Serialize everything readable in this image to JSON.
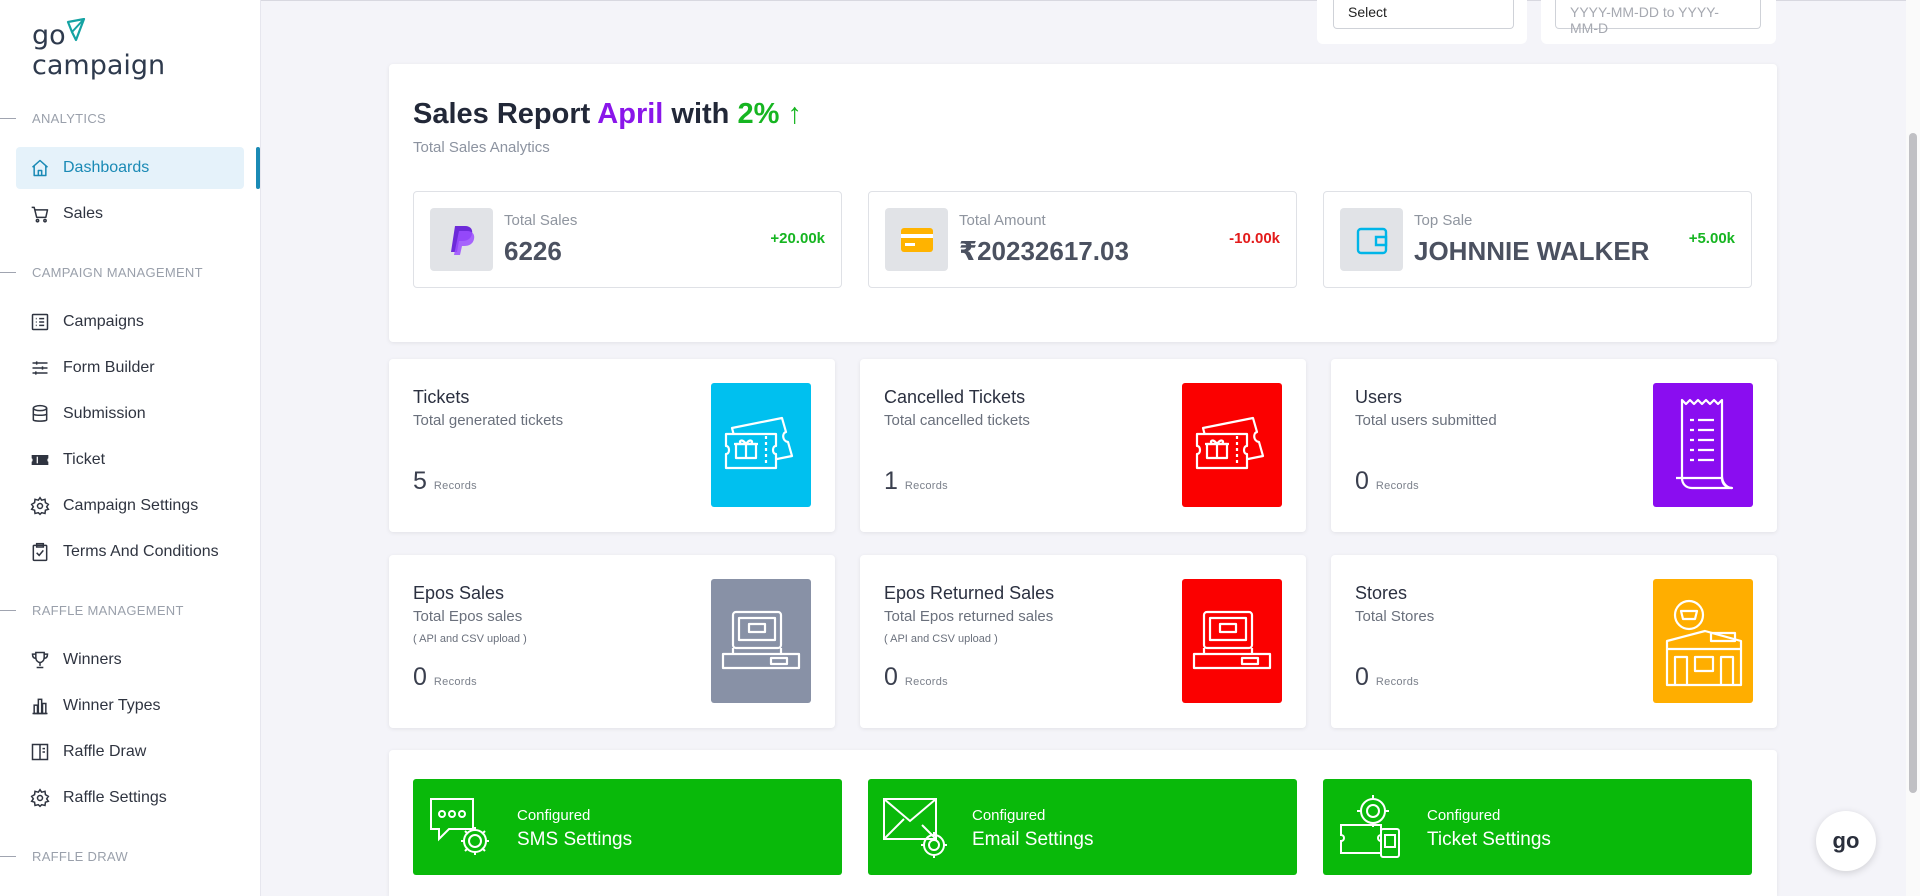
{
  "app": {
    "logo_top": "go",
    "logo_bottom": "campaign"
  },
  "filters": {
    "select_value": "Select",
    "date_placeholder": "YYYY-MM-DD to YYYY-MM-D"
  },
  "sidebar": {
    "sections": [
      {
        "label": "ANALYTICS"
      },
      {
        "label": "CAMPAIGN MANAGEMENT"
      },
      {
        "label": "RAFFLE MANAGEMENT"
      },
      {
        "label": "RAFFLE DRAW"
      }
    ],
    "items": [
      {
        "label": "Dashboards",
        "icon": "home-icon",
        "active": true
      },
      {
        "label": "Sales",
        "icon": "cart-icon"
      },
      {
        "label": "Campaigns",
        "icon": "list-icon"
      },
      {
        "label": "Form Builder",
        "icon": "sliders-icon"
      },
      {
        "label": "Submission",
        "icon": "database-icon"
      },
      {
        "label": "Ticket",
        "icon": "ticket-icon"
      },
      {
        "label": "Campaign Settings",
        "icon": "gear-icon"
      },
      {
        "label": "Terms And Conditions",
        "icon": "clipboard-check-icon"
      },
      {
        "label": "Winners",
        "icon": "trophy-icon"
      },
      {
        "label": "Winner Types",
        "icon": "bar-chart-icon"
      },
      {
        "label": "Raffle Draw",
        "icon": "book-icon"
      },
      {
        "label": "Raffle Settings",
        "icon": "gear-icon"
      }
    ]
  },
  "report": {
    "title_prefix": "Sales Report",
    "month": "April",
    "with": "with",
    "percent": "2%",
    "arrow": "↑",
    "subtitle": "Total Sales Analytics",
    "stats": [
      {
        "label": "Total Sales",
        "value": "6226",
        "change": "+20.00k",
        "change_color": "#16b521",
        "icon": "paypal-icon"
      },
      {
        "label": "Total Amount",
        "value": "₹20232617.03",
        "change": "-10.00k",
        "change_color": "#e31b1b",
        "icon": "credit-card-icon"
      },
      {
        "label": "Top Sale",
        "value": "JOHNNIE WALKER",
        "change": "+5.00k",
        "change_color": "#16b521",
        "icon": "wallet-icon"
      }
    ]
  },
  "cards": [
    {
      "title": "Tickets",
      "subtitle": "Total generated tickets",
      "note": "",
      "count": "5",
      "unit": "Records",
      "color": "#00c0ef",
      "icon": "ticket-gift-icon"
    },
    {
      "title": "Cancelled Tickets",
      "subtitle": "Total cancelled tickets",
      "note": "",
      "count": "1",
      "unit": "Records",
      "color": "#fb0000",
      "icon": "ticket-gift-icon"
    },
    {
      "title": "Users",
      "subtitle": "Total users submitted",
      "note": "",
      "count": "0",
      "unit": "Records",
      "color": "#8a0df0",
      "icon": "receipt-icon"
    },
    {
      "title": "Epos Sales",
      "subtitle": "Total Epos sales",
      "note": "( API and CSV upload )",
      "count": "0",
      "unit": "Records",
      "color": "#8891a6",
      "icon": "cash-register-icon"
    },
    {
      "title": "Epos Returned Sales",
      "subtitle": "Total Epos returned sales",
      "note": "( API and CSV upload )",
      "count": "0",
      "unit": "Records",
      "color": "#fb0000",
      "icon": "cash-register-icon"
    },
    {
      "title": "Stores",
      "subtitle": "Total Stores",
      "note": "",
      "count": "0",
      "unit": "Records",
      "color": "#ffae00",
      "icon": "store-icon"
    }
  ],
  "settings": [
    {
      "status": "Configured",
      "label": "SMS Settings",
      "icon": "sms-gear-icon"
    },
    {
      "status": "Configured",
      "label": "Email Settings",
      "icon": "email-gear-icon"
    },
    {
      "status": "Configured",
      "label": "Ticket Settings",
      "icon": "ticket-settings-icon"
    }
  ],
  "fab": {
    "label": "go"
  }
}
